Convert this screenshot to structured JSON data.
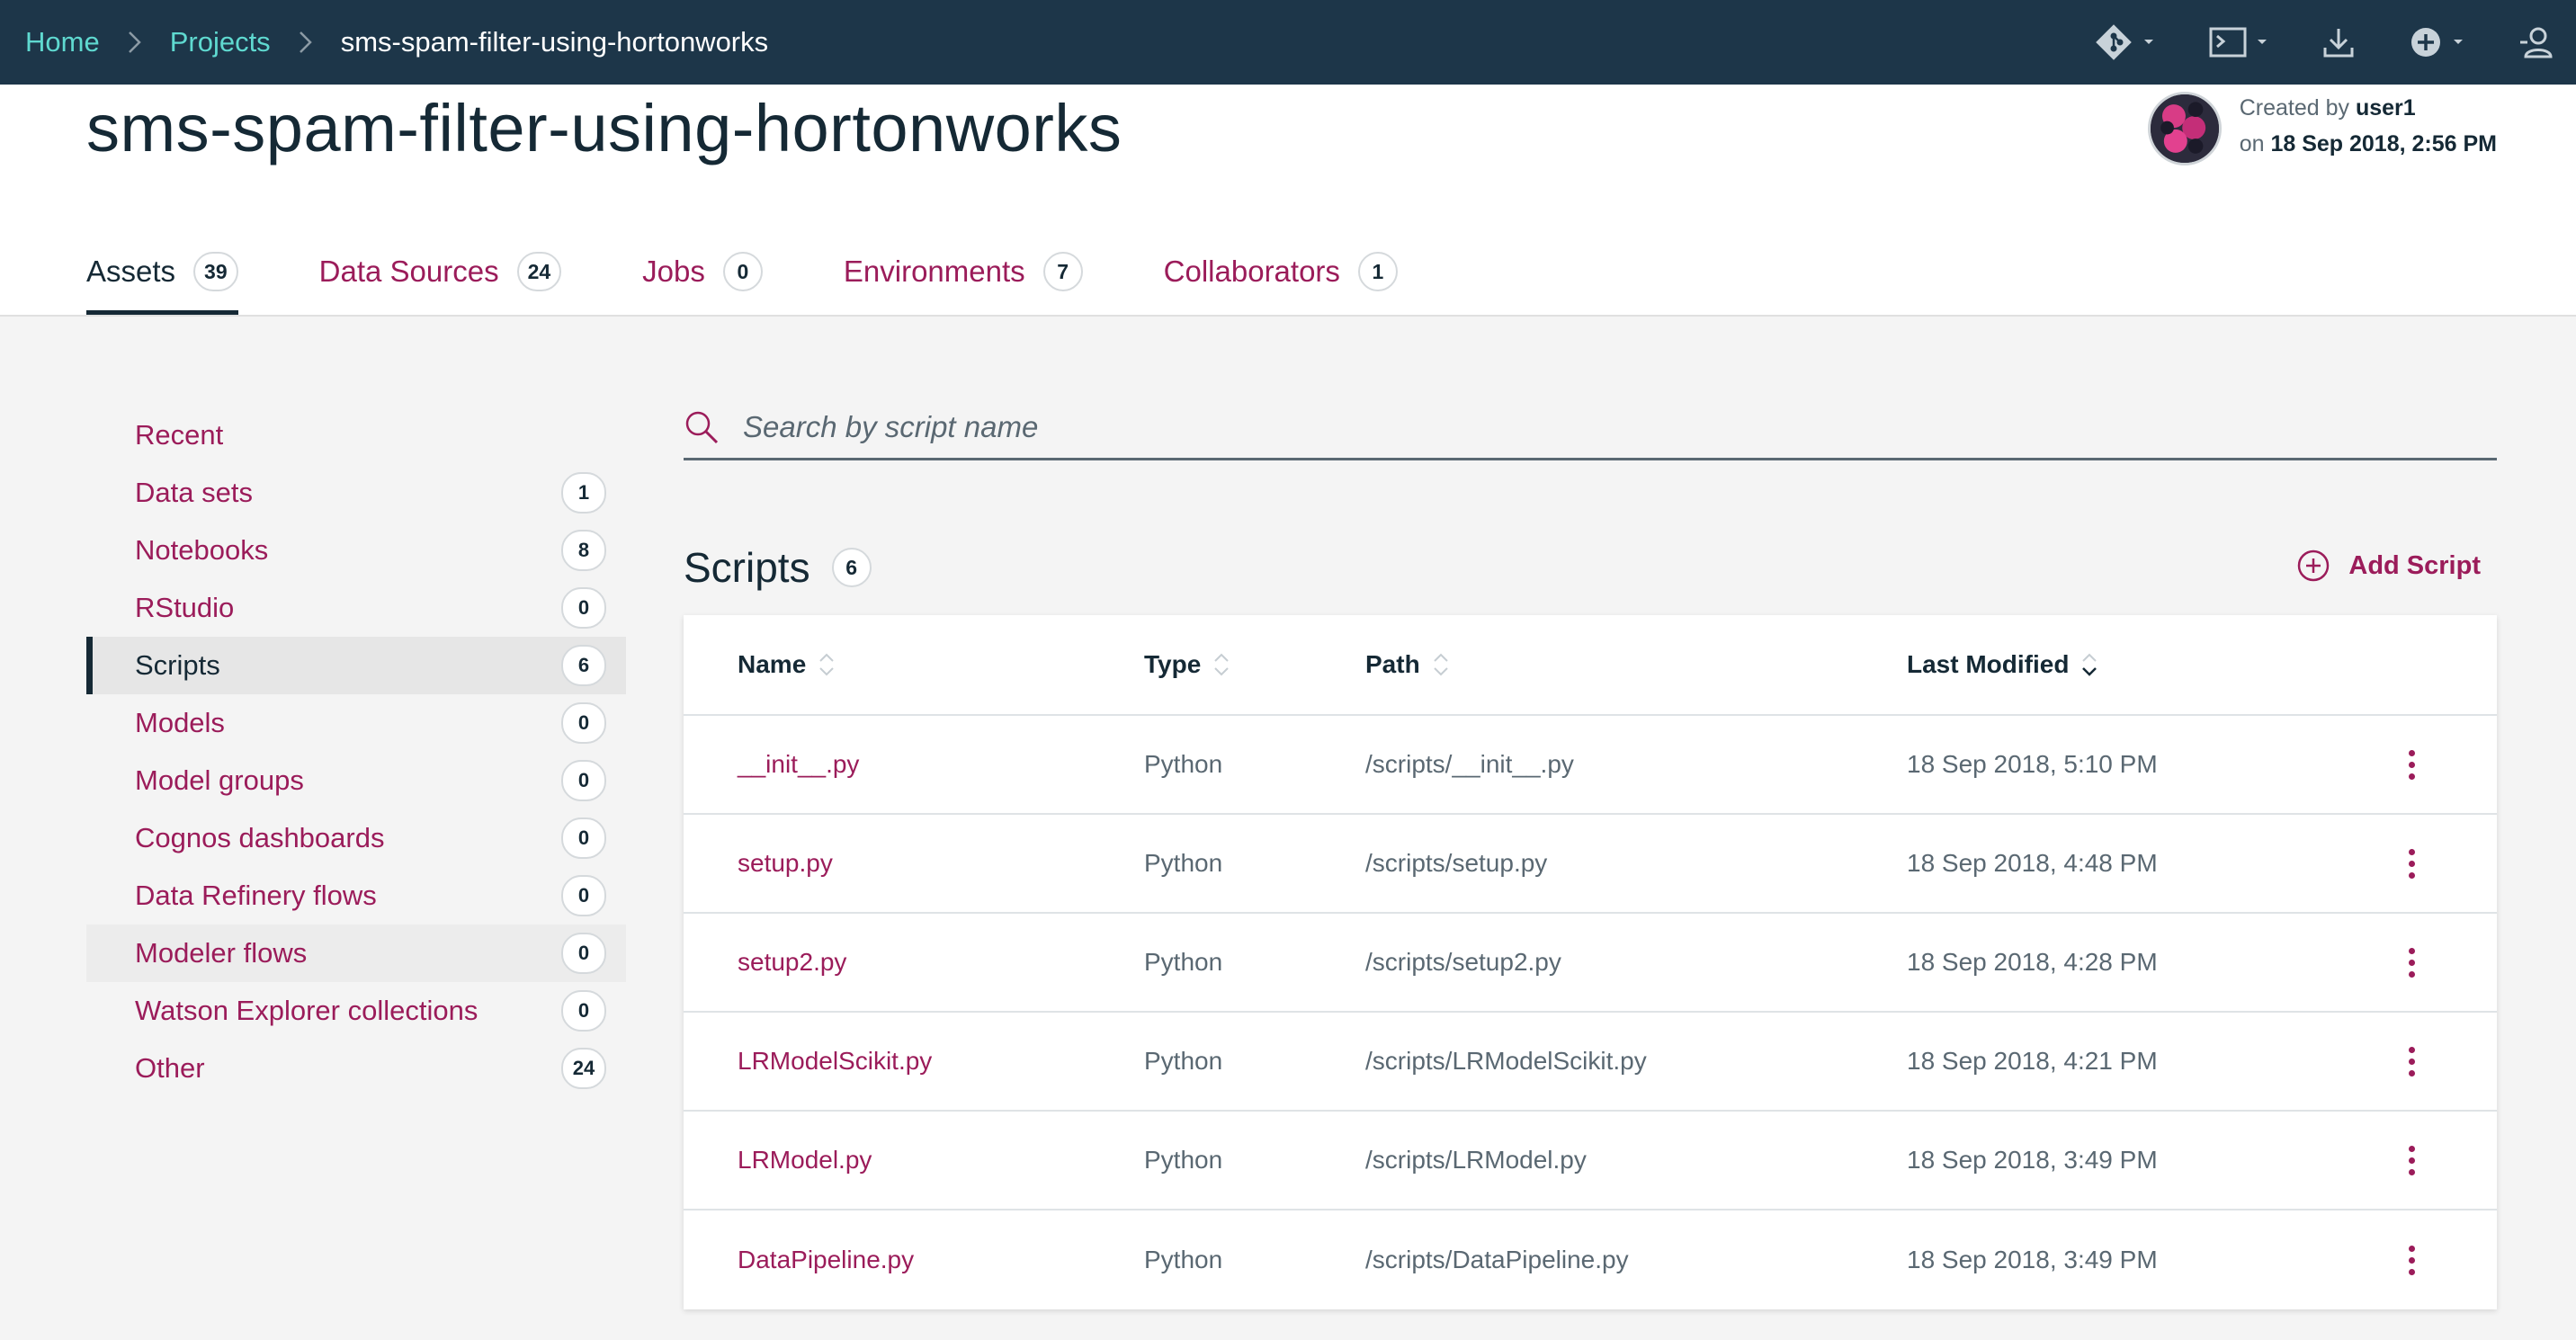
{
  "breadcrumb": {
    "items": [
      "Home",
      "Projects"
    ],
    "current": "sms-spam-filter-using-hortonworks"
  },
  "topbar_icons": [
    "git-icon",
    "terminal-icon",
    "download-icon",
    "add-circle-icon",
    "user-icon"
  ],
  "project": {
    "title": "sms-spam-filter-using-hortonworks",
    "created_by_label": "Created by",
    "created_by": "user1",
    "created_on_label": "on",
    "created_on": "18 Sep 2018, 2:56 PM"
  },
  "tabs": [
    {
      "label": "Assets",
      "count": "39"
    },
    {
      "label": "Data Sources",
      "count": "24"
    },
    {
      "label": "Jobs",
      "count": "0"
    },
    {
      "label": "Environments",
      "count": "7"
    },
    {
      "label": "Collaborators",
      "count": "1"
    }
  ],
  "sidebar": {
    "items": [
      {
        "label": "Recent",
        "count": ""
      },
      {
        "label": "Data sets",
        "count": "1"
      },
      {
        "label": "Notebooks",
        "count": "8"
      },
      {
        "label": "RStudio",
        "count": "0"
      },
      {
        "label": "Scripts",
        "count": "6"
      },
      {
        "label": "Models",
        "count": "0"
      },
      {
        "label": "Model groups",
        "count": "0"
      },
      {
        "label": "Cognos dashboards",
        "count": "0"
      },
      {
        "label": "Data Refinery flows",
        "count": "0"
      },
      {
        "label": "Modeler flows",
        "count": "0"
      },
      {
        "label": "Watson Explorer collections",
        "count": "0"
      },
      {
        "label": "Other",
        "count": "24"
      }
    ]
  },
  "search": {
    "placeholder": "Search by script name",
    "value": ""
  },
  "scripts": {
    "title": "Scripts",
    "count": "6",
    "add_label": "Add Script",
    "columns": [
      "Name",
      "Type",
      "Path",
      "Last Modified"
    ],
    "rows": [
      {
        "name": "__init__.py",
        "type": "Python",
        "path": "/scripts/__init__.py",
        "modified": "18 Sep 2018, 5:10 PM"
      },
      {
        "name": "setup.py",
        "type": "Python",
        "path": "/scripts/setup.py",
        "modified": "18 Sep 2018, 4:48 PM"
      },
      {
        "name": "setup2.py",
        "type": "Python",
        "path": "/scripts/setup2.py",
        "modified": "18 Sep 2018, 4:28 PM"
      },
      {
        "name": "LRModelScikit.py",
        "type": "Python",
        "path": "/scripts/LRModelScikit.py",
        "modified": "18 Sep 2018, 4:21 PM"
      },
      {
        "name": "LRModel.py",
        "type": "Python",
        "path": "/scripts/LRModel.py",
        "modified": "18 Sep 2018, 3:49 PM"
      },
      {
        "name": "DataPipeline.py",
        "type": "Python",
        "path": "/scripts/DataPipeline.py",
        "modified": "18 Sep 2018, 3:49 PM"
      }
    ]
  },
  "colors": {
    "topbar": "#1d3649",
    "breadcrumb_link": "#5fd9d0",
    "accent": "#9b1c5a",
    "text": "#152935"
  }
}
